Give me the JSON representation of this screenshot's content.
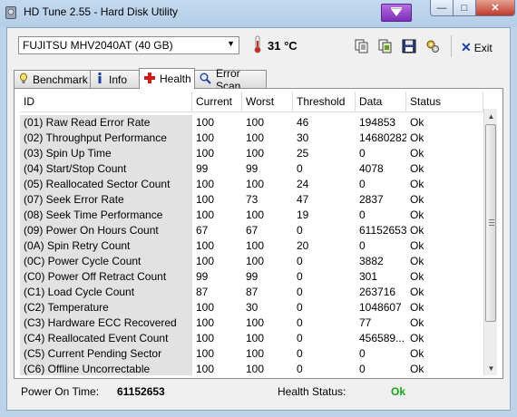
{
  "window": {
    "title": "HD Tune 2.55 - Hard Disk Utility",
    "min": "—",
    "max": "□",
    "close": "✕"
  },
  "toolbar": {
    "drive": "FUJITSU MHV2040AT (40 GB)",
    "temperature": "31 °C",
    "exit_label": "Exit",
    "icons": [
      "copy-icon",
      "copy-screenshot-icon",
      "save-icon",
      "options-icon"
    ]
  },
  "tabs": [
    {
      "label": "Benchmark",
      "icon": "benchmark-icon"
    },
    {
      "label": "Info",
      "icon": "info-icon"
    },
    {
      "label": "Health",
      "icon": "health-icon",
      "active": true
    },
    {
      "label": "Error Scan",
      "icon": "error-scan-icon"
    }
  ],
  "table": {
    "headers": [
      "ID",
      "Current",
      "Worst",
      "Threshold",
      "Data",
      "Status"
    ],
    "rows": [
      [
        "(01) Raw Read Error Rate",
        "100",
        "100",
        "46",
        "194853",
        "Ok"
      ],
      [
        "(02) Throughput Performance",
        "100",
        "100",
        "30",
        "14680282",
        "Ok"
      ],
      [
        "(03) Spin Up Time",
        "100",
        "100",
        "25",
        "0",
        "Ok"
      ],
      [
        "(04) Start/Stop Count",
        "99",
        "99",
        "0",
        "4078",
        "Ok"
      ],
      [
        "(05) Reallocated Sector Count",
        "100",
        "100",
        "24",
        "0",
        "Ok"
      ],
      [
        "(07) Seek Error Rate",
        "100",
        "73",
        "47",
        "2837",
        "Ok"
      ],
      [
        "(08) Seek Time Performance",
        "100",
        "100",
        "19",
        "0",
        "Ok"
      ],
      [
        "(09) Power On Hours Count",
        "67",
        "67",
        "0",
        "61152653",
        "Ok"
      ],
      [
        "(0A) Spin Retry Count",
        "100",
        "100",
        "20",
        "0",
        "Ok"
      ],
      [
        "(0C) Power Cycle Count",
        "100",
        "100",
        "0",
        "3882",
        "Ok"
      ],
      [
        "(C0) Power Off Retract Count",
        "99",
        "99",
        "0",
        "301",
        "Ok"
      ],
      [
        "(C1) Load Cycle Count",
        "87",
        "87",
        "0",
        "263716",
        "Ok"
      ],
      [
        "(C2) Temperature",
        "100",
        "30",
        "0",
        "1048607",
        "Ok"
      ],
      [
        "(C3) Hardware ECC Recovered",
        "100",
        "100",
        "0",
        "77",
        "Ok"
      ],
      [
        "(C4) Reallocated Event Count",
        "100",
        "100",
        "0",
        "456589...",
        "Ok"
      ],
      [
        "(C5) Current Pending Sector",
        "100",
        "100",
        "0",
        "0",
        "Ok"
      ],
      [
        "(C6) Offline Uncorrectable",
        "100",
        "100",
        "0",
        "0",
        "Ok"
      ]
    ]
  },
  "footer": {
    "power_on_label": "Power On Time:",
    "power_on_value": "61152653",
    "health_label": "Health Status:",
    "health_value": "Ok",
    "health_color": "#15a815"
  }
}
